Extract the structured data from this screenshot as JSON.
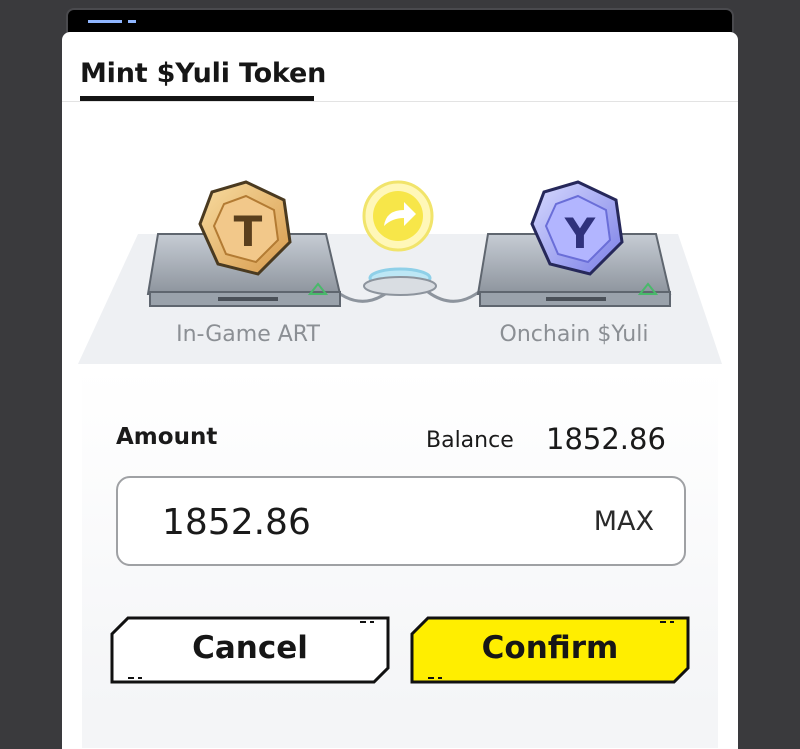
{
  "dialog": {
    "title": "Mint $Yuli Token"
  },
  "illustration": {
    "source_label": "In-Game ART",
    "target_label": "Onchain $Yuli",
    "source_icon": "art-token-icon",
    "target_icon": "yuli-token-icon",
    "convert_icon": "arrow-redo-icon"
  },
  "form": {
    "amount_label": "Amount",
    "balance_label": "Balance",
    "balance_value": "1852.86",
    "amount_value": "1852.86",
    "max_label": "MAX"
  },
  "actions": {
    "cancel_label": "Cancel",
    "confirm_label": "Confirm"
  },
  "colors": {
    "confirm_bg": "#ffee00",
    "accent_gold": "#e9b56a",
    "accent_violet": "#8f93ee"
  }
}
